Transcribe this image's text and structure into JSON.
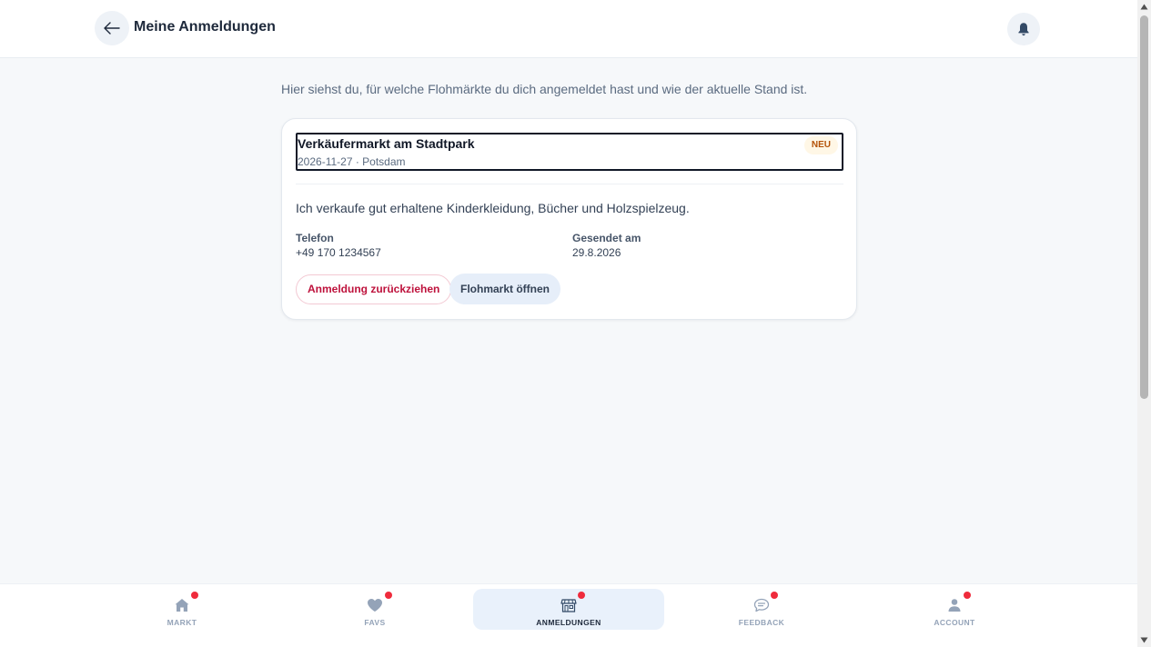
{
  "header": {
    "title": "Meine Anmeldungen",
    "back_icon": "arrow-left-icon",
    "notification_icon": "bell-icon"
  },
  "intro": "Hier siehst du, für welche Flohmärkte du dich angemeldet hast und wie der aktuelle Stand ist.",
  "registration": {
    "market_name": "Verkäufermarkt am Stadtpark",
    "meta": "2026-11-27 · Potsdam",
    "badge": "NEU",
    "message": "Ich verkaufe gut erhaltene Kinderkleidung, Bücher und Holzspielzeug.",
    "phone_label": "Telefon",
    "phone_value": "+49 170 1234567",
    "sent_label": "Gesendet am",
    "sent_value": "29.8.2026",
    "withdraw_label": "Anmeldung zurückziehen",
    "open_label": "Flohmarkt öffnen"
  },
  "nav": {
    "items": [
      {
        "label": "MARKT",
        "icon": "home-icon",
        "active": false,
        "has_dot": true
      },
      {
        "label": "FAVS",
        "icon": "heart-icon",
        "active": false,
        "has_dot": true
      },
      {
        "label": "ANMELDUNGEN",
        "icon": "store-icon",
        "active": true,
        "has_dot": true
      },
      {
        "label": "FEEDBACK",
        "icon": "chat-icon",
        "active": false,
        "has_dot": true
      },
      {
        "label": "ACCOUNT",
        "icon": "user-icon",
        "active": false,
        "has_dot": true
      }
    ]
  },
  "colors": {
    "accent": "#be123c",
    "notification_dot": "#ef2b3c",
    "active_nav_bg": "#e9f1fb",
    "badge_text": "#b45309"
  }
}
